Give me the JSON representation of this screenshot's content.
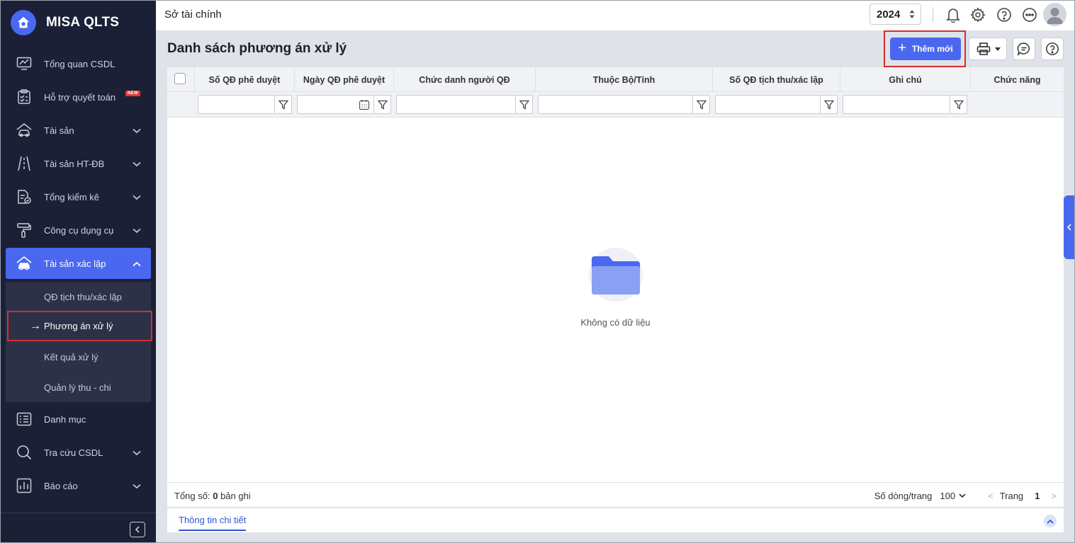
{
  "app": {
    "name": "MISA QLTS",
    "organization": "Sở tài chính",
    "year": "2024"
  },
  "sidebar": {
    "items": [
      {
        "label": "Tổng quan CSDL",
        "icon": "dashboard-icon",
        "chevron": false
      },
      {
        "label": "Hỗ trợ quyết toán",
        "icon": "clipboard-icon",
        "badge": "NEW",
        "chevron": false
      },
      {
        "label": "Tài sản",
        "icon": "house-car-icon",
        "chevron": true
      },
      {
        "label": "Tài sản HT-ĐB",
        "icon": "road-icon",
        "chevron": true
      },
      {
        "label": "Tổng kiểm kê",
        "icon": "inventory-check-icon",
        "chevron": true
      },
      {
        "label": "Công cụ dụng cụ",
        "icon": "paint-roller-icon",
        "chevron": true
      },
      {
        "label": "Tài sản xác lập",
        "icon": "house-car-icon",
        "chevron": true,
        "active": true
      },
      {
        "label": "Danh mục",
        "icon": "list-icon",
        "chevron": false
      },
      {
        "label": "Tra cứu CSDL",
        "icon": "search-icon",
        "chevron": true
      },
      {
        "label": "Báo cáo",
        "icon": "bar-chart-icon",
        "chevron": true
      }
    ],
    "subitems": [
      {
        "label": "QĐ tịch thu/xác lập"
      },
      {
        "label": "Phương án xử lý",
        "current": true
      },
      {
        "label": "Kết quả xử lý"
      },
      {
        "label": "Quản lý thu - chi"
      }
    ],
    "current_arrow": "→"
  },
  "page": {
    "title": "Danh sách phương án xử lý",
    "add_button": "Thêm mới",
    "add_plus": "+"
  },
  "grid": {
    "columns": [
      "Số QĐ phê duyệt",
      "Ngày QĐ phê duyệt",
      "Chức danh người QĐ",
      "Thuộc Bộ/Tỉnh",
      "Số QĐ tịch thu/xác lập",
      "Ghi chú",
      "Chức năng"
    ],
    "empty_text": "Không có dữ liệu",
    "footer": {
      "total_label": "Tổng số:",
      "total_value": "0",
      "total_unit": "bản ghi",
      "rows_per_page_label": "Số dòng/trang",
      "rows_per_page": "100",
      "page_label": "Trang",
      "page": "1",
      "prev": "<",
      "next": ">"
    }
  },
  "detail": {
    "tab_label": "Thông tin chi tiết"
  },
  "colors": {
    "sidebar_bg": "#1b2037",
    "accent": "#4a68ef",
    "highlight_border": "#d32f2f"
  }
}
